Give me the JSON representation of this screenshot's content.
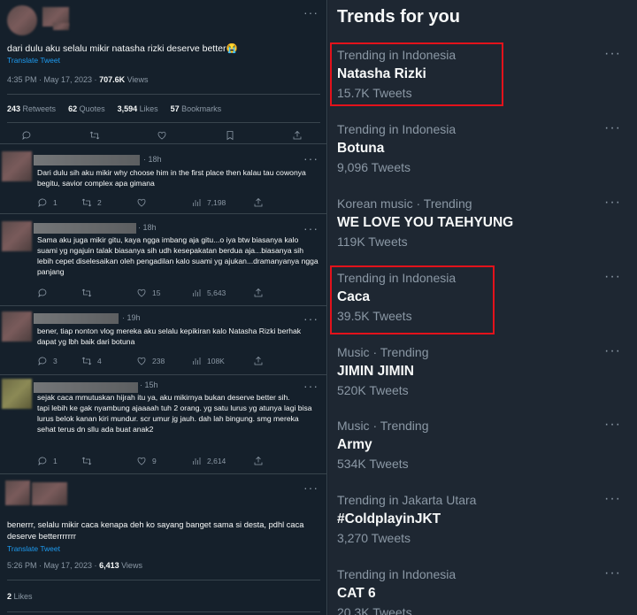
{
  "main_tweet": {
    "text": "dari dulu aku selalu mikir natasha rizki deserve better😭",
    "translate": "Translate Tweet",
    "time": "4:35 PM · May 17, 2023 · ",
    "views_count": "707.6K",
    "views_label": " Views",
    "stats": [
      {
        "count": "243",
        "label": " Retweets"
      },
      {
        "count": "62",
        "label": " Quotes"
      },
      {
        "count": "3,594",
        "label": " Likes"
      },
      {
        "count": "57",
        "label": " Bookmarks"
      }
    ]
  },
  "replies": [
    {
      "time": "· 18h",
      "text": "Dari dulu sih aku mikir why choose him in the first place then kalau tau cowonya begitu, savior complex apa gimana",
      "replies": "1",
      "retweets": "2",
      "likes": "",
      "views": "7,198"
    },
    {
      "time": "· 18h",
      "text": "Sama aku juga mikir gitu, kaya ngga imbang aja gitu...o iya btw biasanya kalo suami yg ngajuin talak biasanya sih udh kesepakatan berdua aja...biasanya sih lebih cepet diselesaikan oleh pengadilan kalo suami yg ajukan...dramanyanya ngga panjang",
      "replies": "",
      "retweets": "",
      "likes": "15",
      "views": "5,643"
    },
    {
      "time": "· 19h",
      "text": "bener, tiap nonton vlog mereka aku selalu kepikiran kalo Natasha Rizki berhak dapat yg lbh baik dari botuna",
      "replies": "3",
      "retweets": "4",
      "likes": "238",
      "views": "108K"
    },
    {
      "time": "· 15h",
      "text": "sejak caca mmutuskan hijrah itu ya, aku mikirnya bukan deserve better sih.\ntapi lebih ke gak nyambung ajaaaah tuh 2 orang. yg satu lurus yg atunya lagi bisa lurus belok kanan kiri mundur. scr umur jg jauh. dah lah bingung. smg mereka sehat terus dn sllu ada buat anak2",
      "replies": "1",
      "retweets": "",
      "likes": "9",
      "views": "2,614"
    }
  ],
  "quote_tweet": {
    "text": "benerrr, selalu mikir caca kenapa deh ko sayang banget sama si desta, pdhl caca deserve betterrrrrrr",
    "translate": "Translate Tweet",
    "time": "5:26 PM · May 17, 2023 · ",
    "views_count": "6,413",
    "views_label": " Views",
    "likes_count": "2",
    "likes_label": " Likes"
  },
  "trends": {
    "title": "Trends for you",
    "items": [
      {
        "context": "Trending in Indonesia",
        "name": "Natasha Rizki",
        "count": "15.7K Tweets"
      },
      {
        "context": "Trending in Indonesia",
        "name": "Botuna",
        "count": "9,096 Tweets"
      },
      {
        "context": "Korean music · Trending",
        "name": "WE LOVE YOU TAEHYUNG",
        "count": "119K Tweets"
      },
      {
        "context": "Trending in Indonesia",
        "name": "Caca",
        "count": "39.5K Tweets"
      },
      {
        "context": "Music · Trending",
        "name": "JIMIN JIMIN",
        "count": "520K Tweets"
      },
      {
        "context": "Music · Trending",
        "name": "Army",
        "count": "534K Tweets"
      },
      {
        "context": "Trending in Jakarta Utara",
        "name": "#ColdplayinJKT",
        "count": "3,270 Tweets"
      },
      {
        "context": "Trending in Indonesia",
        "name": "CAT 6",
        "count": "20.3K Tweets"
      }
    ]
  },
  "colors": {
    "background": "#15202b",
    "accent": "#1d9bf0",
    "highlight": "#e3121b"
  }
}
